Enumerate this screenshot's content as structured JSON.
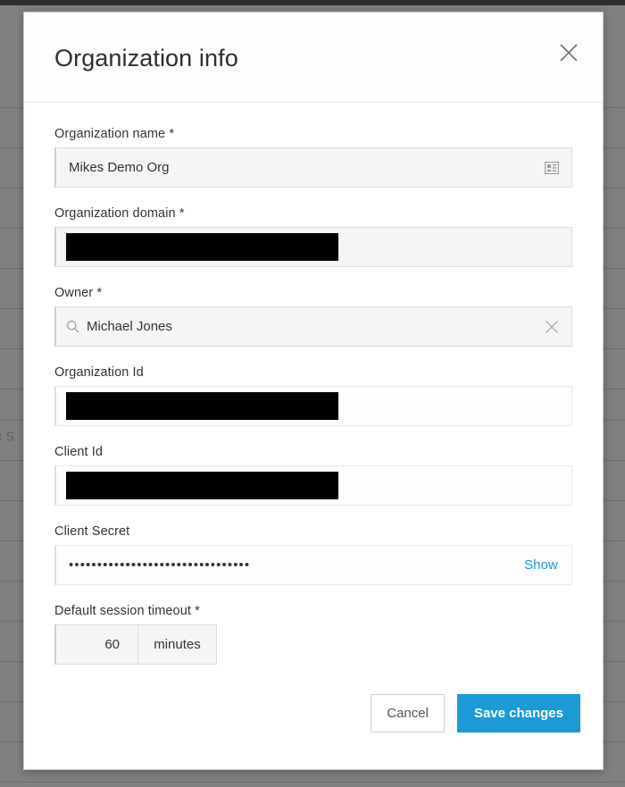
{
  "background": {
    "cell_text": "ic S",
    "row_line_positions": [
      120,
      165,
      210,
      255,
      300,
      345,
      390,
      435,
      470,
      515,
      560,
      605,
      650,
      695,
      740,
      785,
      830,
      875
    ],
    "overlay_color": "#808080",
    "topbar_color": "#2d2d2d"
  },
  "dialog": {
    "title": "Organization info",
    "close_icon": "close-icon",
    "fields": [
      {
        "id": "organization-name",
        "label": "Organization name",
        "required": true,
        "required_marker": "*",
        "value": "Mikes Demo Org",
        "redacted": false,
        "readonly": false,
        "trailing_icon": "contact-card-icon"
      },
      {
        "id": "organization-domain",
        "label": "Organization domain",
        "required": true,
        "required_marker": "*",
        "value": "",
        "redacted": true,
        "readonly": false,
        "trailing_icon": null
      },
      {
        "id": "owner",
        "label": "Owner",
        "required": true,
        "required_marker": "*",
        "value": "Michael Jones",
        "redacted": false,
        "readonly": false,
        "leading_icon": "search-icon",
        "trailing_icon": "clear-icon"
      },
      {
        "id": "organization-id",
        "label": "Organization Id",
        "required": false,
        "required_marker": "",
        "value": "",
        "redacted": true,
        "readonly": true,
        "trailing_icon": null
      },
      {
        "id": "client-id",
        "label": "Client Id",
        "required": false,
        "required_marker": "",
        "value": "",
        "redacted": true,
        "readonly": true,
        "trailing_icon": null
      }
    ],
    "client_secret": {
      "label": "Client Secret",
      "masked_value": "••••••••••••••••••••••••••••••••",
      "show_label": "Show",
      "show_link_color": "#1b9ad6"
    },
    "session_timeout": {
      "label": "Default session timeout",
      "required_marker": "*",
      "value": "60",
      "unit": "minutes"
    },
    "footer": {
      "cancel_label": "Cancel",
      "save_label": "Save changes",
      "save_color": "#1b9ad6"
    }
  }
}
